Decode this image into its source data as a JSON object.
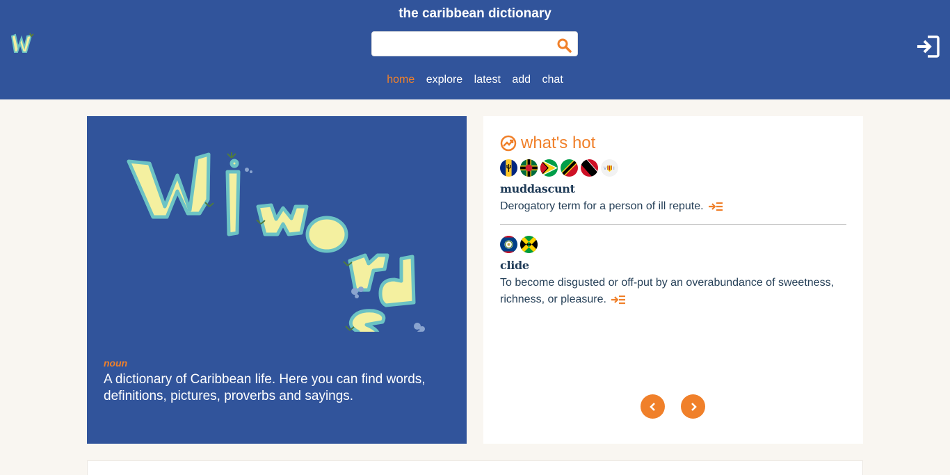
{
  "header": {
    "title": "the caribbean dictionary",
    "search_placeholder": "",
    "nav": [
      "home",
      "explore",
      "latest",
      "add",
      "chat"
    ],
    "active_nav": "home",
    "icons": {
      "logo": "wiwords-logo-icon",
      "search": "search-icon",
      "login": "login-icon"
    }
  },
  "hero": {
    "art_text": "Wiwords",
    "part_of_speech": "noun",
    "definition": "A dictionary of Caribbean life. Here you can find words, definitions, pictures, proverbs and sayings."
  },
  "hot": {
    "title": "what's hot",
    "icon": "trending-icon",
    "entries": [
      {
        "flags": [
          "barbados",
          "dominica",
          "guyana",
          "st-kitts-nevis",
          "trinidad-tobago",
          "us-virgin-islands"
        ],
        "word": "muddascunt",
        "definition": "Derogatory term for a person of ill repute."
      },
      {
        "flags": [
          "belize",
          "jamaica"
        ],
        "word": "clide",
        "definition": "To become disgusted or off-put by an overabundance of sweetness, richness, or pleasure."
      }
    ],
    "prev_icon": "chevron-left-icon",
    "next_icon": "chevron-right-icon"
  },
  "colors": {
    "brand_blue": "#31549b",
    "accent_orange": "#f0802a",
    "background": "#f9f6f1"
  }
}
